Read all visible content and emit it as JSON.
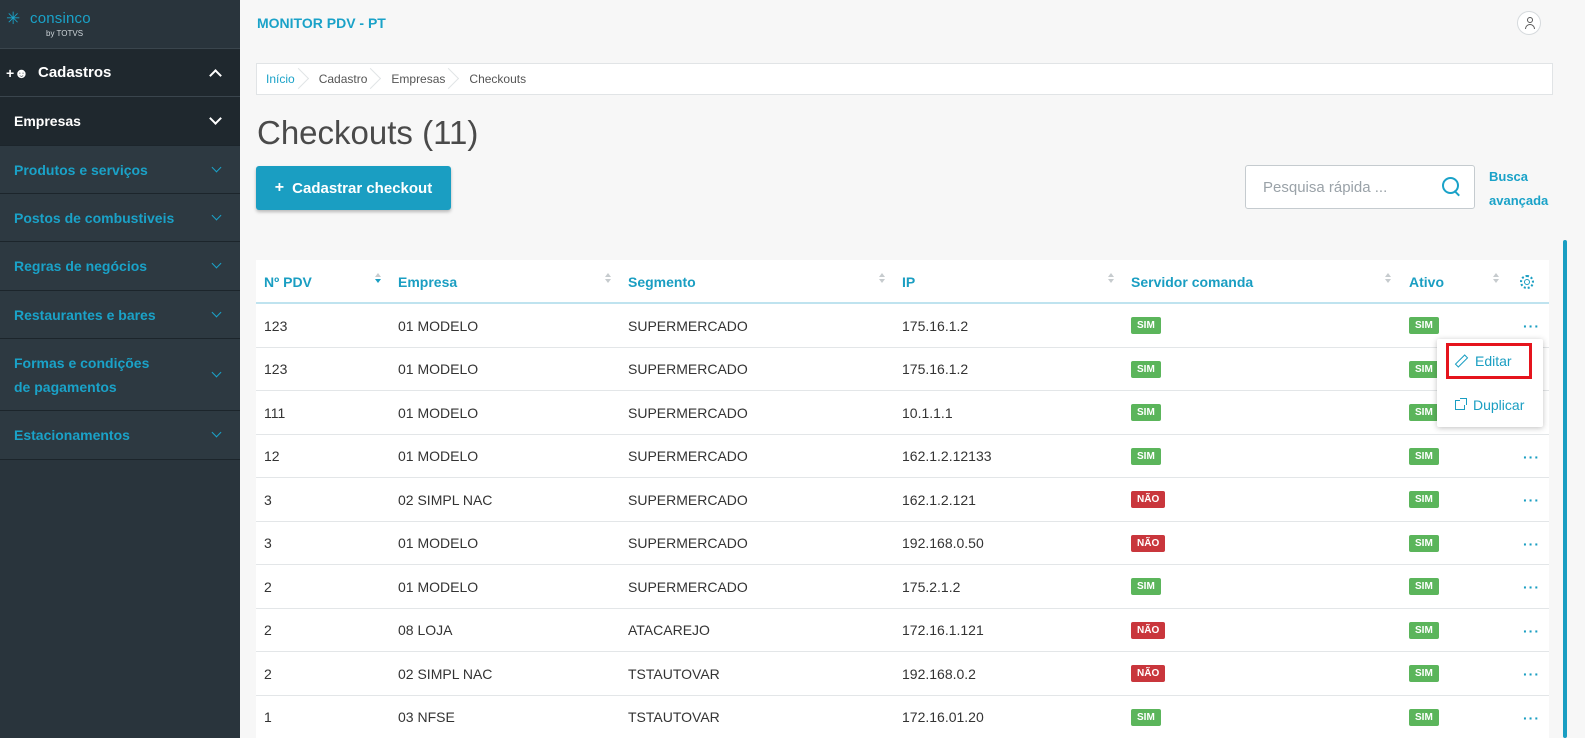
{
  "logo": {
    "name": "consinco",
    "sub": "by TOTVS"
  },
  "sidebar": {
    "section": {
      "label": "Cadastros"
    },
    "items": [
      {
        "label": "Empresas"
      },
      {
        "label": "Produtos e serviços"
      },
      {
        "label": "Postos de combustiveis"
      },
      {
        "label": "Regras de negócios"
      },
      {
        "label": "Restaurantes e bares"
      },
      {
        "label": "Formas e condições de pagamentos"
      },
      {
        "label": "Estacionamentos"
      }
    ]
  },
  "header": {
    "title": "MONITOR PDV - PT"
  },
  "breadcrumb": [
    "Início",
    "Cadastro",
    "Empresas",
    "Checkouts"
  ],
  "page": {
    "title": "Checkouts (11)"
  },
  "toolbar": {
    "add_label": "Cadastrar checkout",
    "add_plus": "+"
  },
  "search": {
    "placeholder": "Pesquisa rápida ...",
    "advanced": "Busca avançada"
  },
  "table": {
    "columns": [
      "Nº PDV",
      "Empresa",
      "Segmento",
      "IP",
      "Servidor comanda",
      "Ativo"
    ],
    "rows": [
      {
        "pdv": "123",
        "empresa": "01 MODELO",
        "segmento": "SUPERMERCADO",
        "ip": "175.16.1.2",
        "servidor": "SIM",
        "ativo": "SIM"
      },
      {
        "pdv": "123",
        "empresa": "01 MODELO",
        "segmento": "SUPERMERCADO",
        "ip": "175.16.1.2",
        "servidor": "SIM",
        "ativo": "SIM"
      },
      {
        "pdv": "111",
        "empresa": "01 MODELO",
        "segmento": "SUPERMERCADO",
        "ip": "10.1.1.1",
        "servidor": "SIM",
        "ativo": "SIM"
      },
      {
        "pdv": "12",
        "empresa": "01 MODELO",
        "segmento": "SUPERMERCADO",
        "ip": "162.1.2.12133",
        "servidor": "SIM",
        "ativo": "SIM"
      },
      {
        "pdv": "3",
        "empresa": "02 SIMPL NAC",
        "segmento": "SUPERMERCADO",
        "ip": "162.1.2.121",
        "servidor": "NÃO",
        "ativo": "SIM"
      },
      {
        "pdv": "3",
        "empresa": "01 MODELO",
        "segmento": "SUPERMERCADO",
        "ip": "192.168.0.50",
        "servidor": "NÃO",
        "ativo": "SIM"
      },
      {
        "pdv": "2",
        "empresa": "01 MODELO",
        "segmento": "SUPERMERCADO",
        "ip": "175.2.1.2",
        "servidor": "SIM",
        "ativo": "SIM"
      },
      {
        "pdv": "2",
        "empresa": "08 LOJA",
        "segmento": "ATACAREJO",
        "ip": "172.16.1.121",
        "servidor": "NÃO",
        "ativo": "SIM"
      },
      {
        "pdv": "2",
        "empresa": "02 SIMPL NAC",
        "segmento": "TSTAUTOVAR",
        "ip": "192.168.0.2",
        "servidor": "NÃO",
        "ativo": "SIM"
      },
      {
        "pdv": "1",
        "empresa": "03 NFSE",
        "segmento": "TSTAUTOVAR",
        "ip": "172.16.01.20",
        "servidor": "SIM",
        "ativo": "SIM"
      }
    ]
  },
  "row_menu": {
    "edit": "Editar",
    "duplicate": "Duplicar"
  },
  "colors": {
    "accent": "#1a9ec2",
    "sidebar": "#29343c",
    "sim": "#5bb55b",
    "nao": "#c9363c",
    "highlight": "#e5141d"
  }
}
